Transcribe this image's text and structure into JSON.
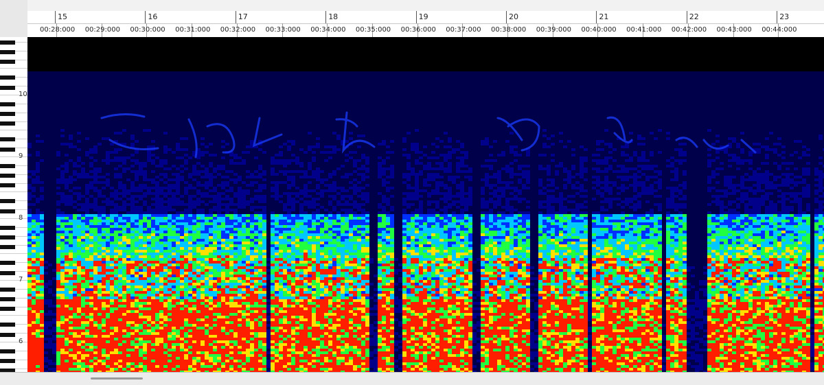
{
  "ruler": {
    "bars": [
      "15",
      "16",
      "17",
      "18",
      "19",
      "20",
      "21",
      "22",
      "23"
    ],
    "times": [
      "00:28:000",
      "00:29:000",
      "00:30:000",
      "00:31:000",
      "00:32:000",
      "00:33:000",
      "00:34:000",
      "00:35:000",
      "00:36:000",
      "00:37:000",
      "00:38:000",
      "00:39:000",
      "00:40:000",
      "00:41:000",
      "00:42:000",
      "00:43:000",
      "00:44:000"
    ]
  },
  "keyboard": {
    "octave_labels": [
      "10",
      "9",
      "8",
      "7",
      "6"
    ]
  },
  "spectrogram": {
    "colormap": [
      "#000010",
      "#00008a",
      "#0030ff",
      "#00c8ff",
      "#20ff40",
      "#ffe000",
      "#ff1e00"
    ],
    "handwritten_text": "ごめんね やさしい"
  }
}
